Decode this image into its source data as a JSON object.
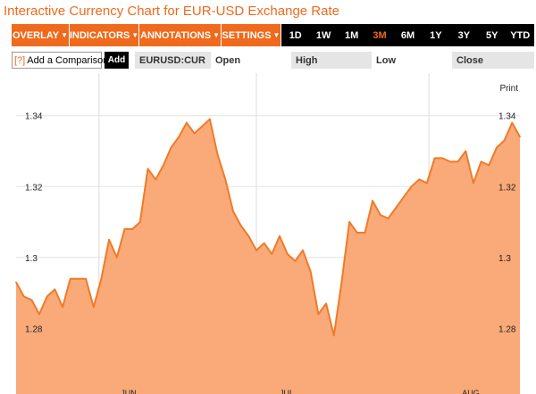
{
  "page_title": "Interactive Currency Chart for EUR-USD Exchange Rate",
  "toolbar": {
    "menus": [
      {
        "label": "OVERLAY"
      },
      {
        "label": "INDICATORS"
      },
      {
        "label": "ANNOTATIONS"
      },
      {
        "label": "SETTINGS"
      }
    ],
    "ranges": [
      "1D",
      "1W",
      "1M",
      "3M",
      "6M",
      "1Y",
      "3Y",
      "5Y",
      "YTD"
    ],
    "active_range": "3M",
    "caret_glyph": "▼"
  },
  "compare": {
    "help_text": "[?]",
    "placeholder": "Add a Comparison",
    "add_label": "Add"
  },
  "quote": {
    "symbol": "EURUSD:CUR",
    "open_label": "Open",
    "high_label": "High",
    "low_label": "Low",
    "close_label": "Close"
  },
  "print_label": "Print",
  "colors": {
    "accent": "#ef6a1c",
    "line": "#f07a28",
    "fill": "#f9aa78"
  },
  "chart_data": {
    "type": "area",
    "yticks": [
      1.28,
      1.3,
      1.32,
      1.34
    ],
    "ytick_labels": [
      "1.28",
      "1.3",
      "1.32",
      "1.34"
    ],
    "ylim": [
      1.266,
      1.352
    ],
    "xlabels": [
      "JUN",
      "JUL",
      "AUG"
    ],
    "grid": true,
    "values": [
      1.293,
      1.289,
      1.288,
      1.284,
      1.289,
      1.291,
      1.286,
      1.294,
      1.294,
      1.294,
      1.286,
      1.294,
      1.305,
      1.3,
      1.308,
      1.308,
      1.31,
      1.325,
      1.322,
      1.326,
      1.331,
      1.334,
      1.338,
      1.335,
      1.337,
      1.339,
      1.329,
      1.322,
      1.313,
      1.309,
      1.306,
      1.302,
      1.304,
      1.301,
      1.306,
      1.301,
      1.299,
      1.302,
      1.296,
      1.284,
      1.287,
      1.278,
      1.293,
      1.31,
      1.307,
      1.307,
      1.316,
      1.312,
      1.311,
      1.314,
      1.317,
      1.32,
      1.322,
      1.321,
      1.328,
      1.328,
      1.327,
      1.327,
      1.33,
      1.321,
      1.327,
      1.326,
      1.331,
      1.333,
      1.338,
      1.334
    ]
  }
}
